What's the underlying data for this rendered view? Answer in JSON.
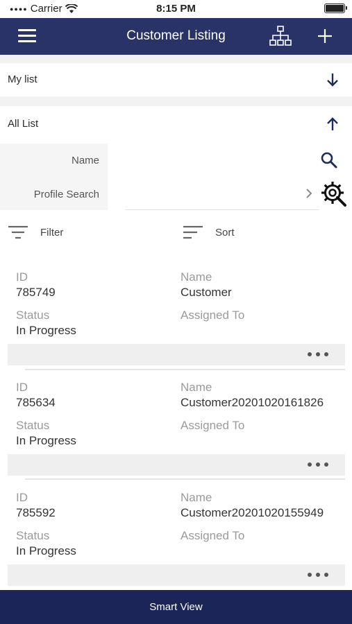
{
  "status_bar": {
    "carrier": "Carrier",
    "time": "8:15 PM"
  },
  "header": {
    "title": "Customer Listing"
  },
  "lists": {
    "my_list": {
      "label": "My list",
      "arrow": "arrow-down-icon"
    },
    "all_list": {
      "label": "All List",
      "arrow": "arrow-up-icon"
    }
  },
  "search": {
    "name_label": "Name",
    "name_value": "",
    "profile_label": "Profile Search"
  },
  "controls": {
    "filter_label": "Filter",
    "sort_label": "Sort"
  },
  "labels": {
    "id": "ID",
    "name": "Name",
    "status": "Status",
    "assigned_to": "Assigned To"
  },
  "records": [
    {
      "id": "785749",
      "name": "Customer",
      "status": "In Progress",
      "assigned_to": ""
    },
    {
      "id": "785634",
      "name": "Customer20201020161826",
      "status": "In Progress",
      "assigned_to": ""
    },
    {
      "id": "785592",
      "name": "Customer20201020155949",
      "status": "In Progress",
      "assigned_to": ""
    }
  ],
  "bottom_bar": {
    "label": "Smart View"
  },
  "colors": {
    "nav": "#2a3368",
    "bottom": "#1c2558",
    "accent": "#1f2a5e"
  }
}
